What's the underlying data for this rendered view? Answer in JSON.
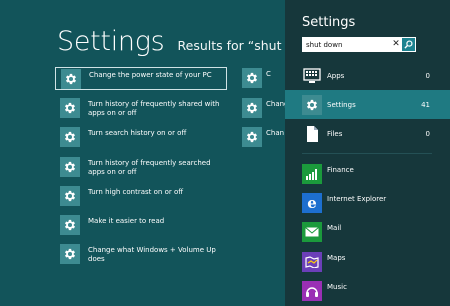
{
  "header": {
    "title": "Settings",
    "results_for": "Results for “shut down”"
  },
  "results": [
    {
      "label": "Change the power state of your PC",
      "selected": true
    },
    {
      "label": "Turn history of frequently shared with apps on or off"
    },
    {
      "label": "Turn search history on or off"
    },
    {
      "label": "Turn history of frequently searched apps on or off"
    },
    {
      "label": "Turn high contrast on or off"
    },
    {
      "label": "Make it easier to read"
    },
    {
      "label": "Change what Windows + Volume Up does"
    }
  ],
  "results_col2": [
    {
      "label": "C"
    },
    {
      "label": "Chang"
    },
    {
      "label": "Chan"
    }
  ],
  "charm": {
    "title": "Settings",
    "search_value": "shut down",
    "scopes": [
      {
        "label": "Apps",
        "count": "0",
        "icon": "apps-icon"
      },
      {
        "label": "Settings",
        "count": "41",
        "icon": "gear-icon",
        "active": true
      },
      {
        "label": "Files",
        "count": "0",
        "icon": "file-icon"
      }
    ],
    "apps": [
      {
        "label": "Finance",
        "icon": "finance-icon",
        "color": "#1b9a3c"
      },
      {
        "label": "Internet Explorer",
        "icon": "ie-icon",
        "color": "#1d6fcf"
      },
      {
        "label": "Mail",
        "icon": "mail-icon",
        "color": "#1b9a3c"
      },
      {
        "label": "Maps",
        "icon": "maps-icon",
        "color": "#6b3fb8"
      },
      {
        "label": "Music",
        "icon": "music-icon",
        "color": "#9a2fb5"
      }
    ]
  },
  "colors": {
    "background": "#12545a",
    "charm_background": "#16373b",
    "tile": "#3d8b91",
    "active_scope": "#1f7a82"
  }
}
